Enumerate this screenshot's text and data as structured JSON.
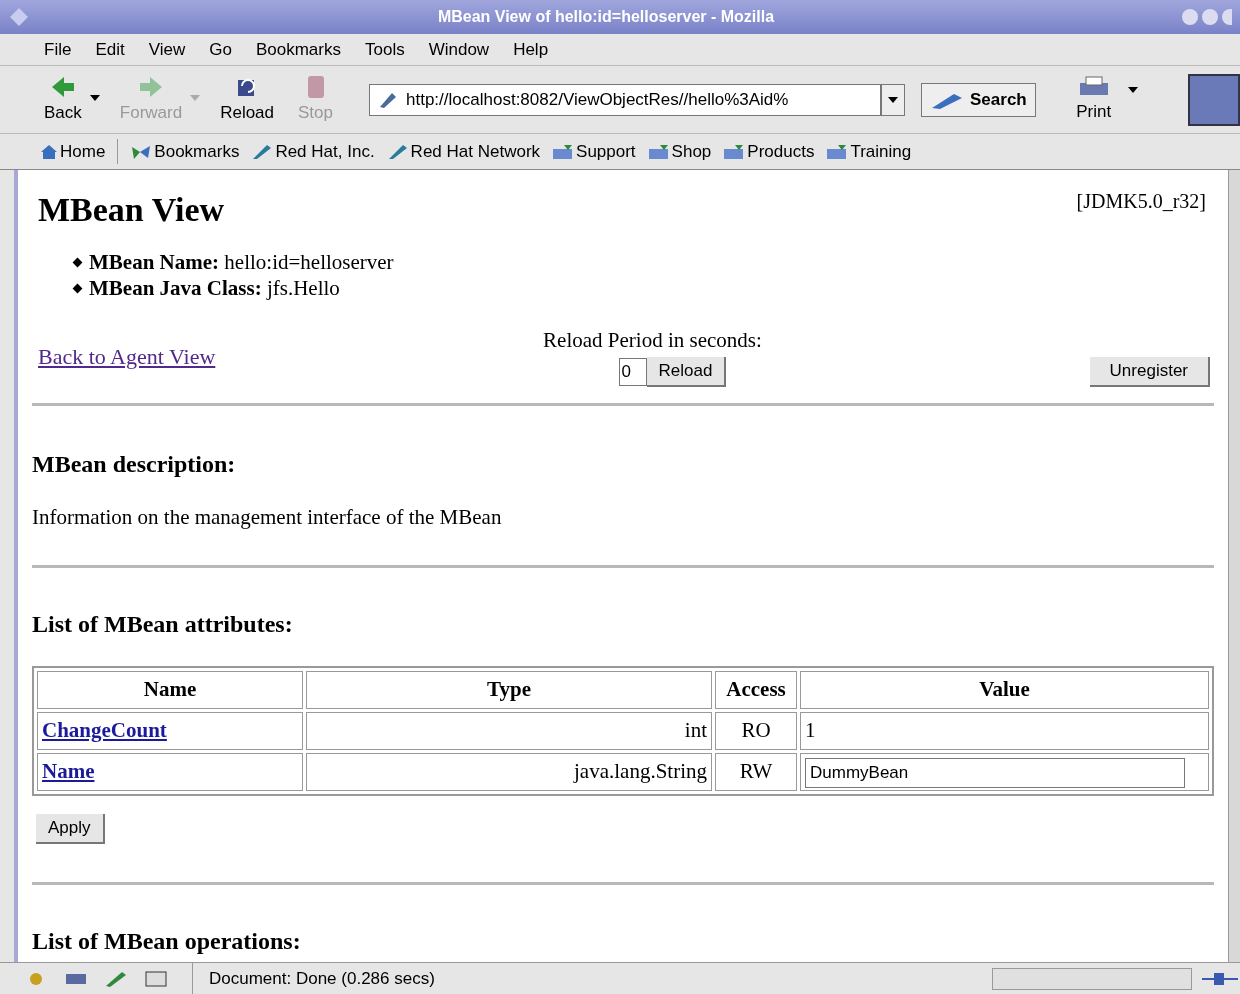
{
  "window": {
    "title": "MBean View of hello:id=helloserver - Mozilla"
  },
  "menu": [
    {
      "label": "File"
    },
    {
      "label": "Edit"
    },
    {
      "label": "View"
    },
    {
      "label": "Go"
    },
    {
      "label": "Bookmarks"
    },
    {
      "label": "Tools"
    },
    {
      "label": "Window"
    },
    {
      "label": "Help"
    }
  ],
  "toolbar": {
    "buttons": [
      {
        "label": "Back",
        "kind": "back",
        "disabled": false
      },
      {
        "label": "Forward",
        "kind": "forward",
        "disabled": true
      },
      {
        "label": "Reload",
        "kind": "reload",
        "disabled": false
      },
      {
        "label": "Stop",
        "kind": "stop",
        "disabled": true
      }
    ],
    "address": "http://localhost:8082/ViewObjectRes//hello%3Aid%",
    "search": "Search",
    "print": "Print"
  },
  "bookmarks": [
    {
      "label": "Home",
      "kind": "home"
    },
    {
      "label": "Bookmarks",
      "kind": "bookmarks"
    },
    {
      "label": "Red Hat, Inc.",
      "kind": "link"
    },
    {
      "label": "Red Hat Network",
      "kind": "link"
    },
    {
      "label": "Support",
      "kind": "folder"
    },
    {
      "label": "Shop",
      "kind": "folder"
    },
    {
      "label": "Products",
      "kind": "folder"
    },
    {
      "label": "Training",
      "kind": "folder"
    }
  ],
  "page": {
    "title": "MBean View",
    "version": "[JDMK5.0_r32]",
    "info": [
      {
        "label": "MBean Name:",
        "value": "hello:id=helloserver"
      },
      {
        "label": "MBean Java Class:",
        "value": "jfs.Hello"
      }
    ],
    "back_link": "Back to Agent View",
    "reload_label": "Reload Period in seconds:",
    "reload_value": "0",
    "reload_button": "Reload",
    "unregister_button": "Unregister",
    "description_heading": "MBean description:",
    "description": "Information on the management interface of the MBean",
    "attributes_heading": "List of MBean attributes:",
    "table": {
      "columns": [
        "Name",
        "Type",
        "Access",
        "Value"
      ],
      "rows": [
        {
          "name": "ChangeCount",
          "type": "int",
          "access": "RO",
          "value": "1",
          "editable": false
        },
        {
          "name": "Name",
          "type": "java.lang.String",
          "access": "RW",
          "value": "DummyBean",
          "editable": true
        }
      ]
    },
    "apply_button": "Apply",
    "operations_heading": "List of MBean operations:"
  },
  "status_bar": {
    "text": "Document: Done (0.286 secs)"
  }
}
